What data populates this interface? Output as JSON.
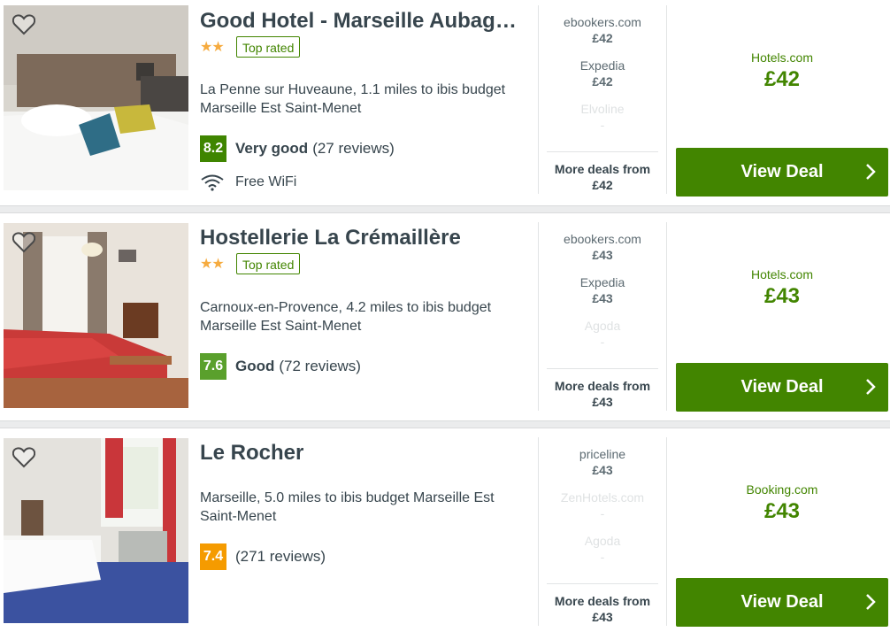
{
  "hotels": [
    {
      "name": "Good Hotel - Marseille Aubagne...",
      "stars": "★★",
      "badge": "Top rated",
      "location": "La Penne sur Huveaune, 1.1 miles to ibis budget Marseille Est Saint-Menet",
      "score": "8.2",
      "score_color": "#3f8500",
      "rating_label": "Very good",
      "reviews": "(27 reviews)",
      "amenity": "Free WiFi",
      "deals": [
        {
          "provider": "ebookers.com",
          "price": "£42"
        },
        {
          "provider": "Expedia",
          "price": "£42"
        },
        {
          "provider": "Elvoline",
          "price": "-"
        }
      ],
      "more_label": "More deals from",
      "more_price": "£42",
      "main_provider": "Hotels.com",
      "main_price": "£42",
      "cta": "View Deal"
    },
    {
      "name": "Hostellerie La Crémaillère",
      "stars": "★★",
      "badge": "Top rated",
      "location": "Carnoux-en-Provence, 4.2 miles to ibis budget Marseille Est Saint-Menet",
      "score": "7.6",
      "score_color": "#5aa02c",
      "rating_label": "Good",
      "reviews": "(72 reviews)",
      "deals": [
        {
          "provider": "ebookers.com",
          "price": "£43"
        },
        {
          "provider": "Expedia",
          "price": "£43"
        },
        {
          "provider": "Agoda",
          "price": "-"
        }
      ],
      "more_label": "More deals from",
      "more_price": "£43",
      "main_provider": "Hotels.com",
      "main_price": "£43",
      "cta": "View Deal"
    },
    {
      "name": "Le Rocher",
      "location": "Marseille, 5.0 miles to ibis budget Marseille Est Saint-Menet",
      "score": "7.4",
      "score_color": "#f59b00",
      "reviews": "(271 reviews)",
      "deals": [
        {
          "provider": "priceline",
          "price": "£43"
        },
        {
          "provider": "ZenHotels.com",
          "price": "-"
        },
        {
          "provider": "Agoda",
          "price": "-"
        }
      ],
      "more_label": "More deals from",
      "more_price": "£43",
      "main_provider": "Booking.com",
      "main_price": "£43",
      "cta": "View Deal"
    }
  ],
  "icons": {
    "favorite": "heart-icon",
    "wifi": "wifi-icon",
    "chevron": "chevron-right-icon"
  }
}
